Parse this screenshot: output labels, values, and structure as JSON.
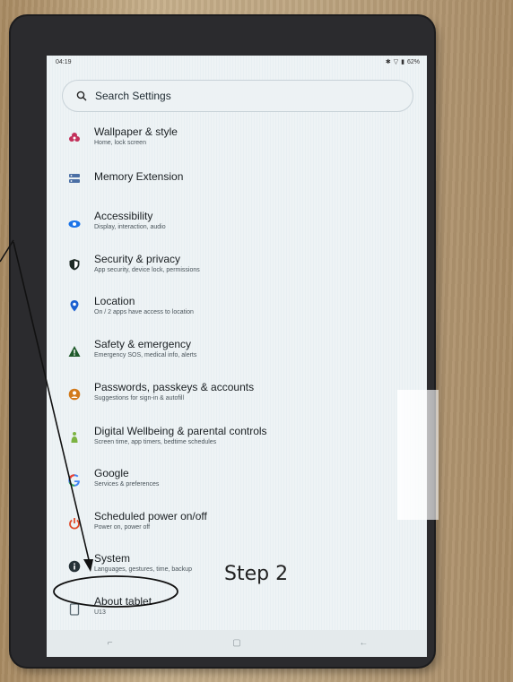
{
  "status_bar": {
    "time": "04:19",
    "battery": "62%"
  },
  "search": {
    "label": "Search Settings"
  },
  "settings": [
    {
      "title": "Wallpaper & style",
      "subtitle": "Home, lock screen",
      "icon": "flower-icon",
      "color": "#c2305a"
    },
    {
      "title": "Memory Extension",
      "subtitle": "",
      "icon": "memory-icon",
      "color": "#4a6fa5"
    },
    {
      "title": "Accessibility",
      "subtitle": "Display, interaction, audio",
      "icon": "accessibility-icon",
      "color": "#1a73e8"
    },
    {
      "title": "Security & privacy",
      "subtitle": "App security, device lock, permissions",
      "icon": "shield-icon",
      "color": "#1e2a24"
    },
    {
      "title": "Location",
      "subtitle": "On / 2 apps have access to location",
      "icon": "location-pin-icon",
      "color": "#1a5fd0"
    },
    {
      "title": "Safety & emergency",
      "subtitle": "Emergency SOS, medical info, alerts",
      "icon": "warning-icon",
      "color": "#1f5a2b"
    },
    {
      "title": "Passwords, passkeys & accounts",
      "subtitle": "Suggestions for sign-in & autofill",
      "icon": "account-icon",
      "color": "#d27a1a"
    },
    {
      "title": "Digital Wellbeing & parental controls",
      "subtitle": "Screen time, app timers, bedtime schedules",
      "icon": "wellbeing-icon",
      "color": "#7cb342"
    },
    {
      "title": "Google",
      "subtitle": "Services & preferences",
      "icon": "google-icon",
      "color": "#4285f4"
    },
    {
      "title": "Scheduled power on/off",
      "subtitle": "Power on, power off",
      "icon": "power-icon",
      "color": "#e04b2c"
    },
    {
      "title": "System",
      "subtitle": "Languages, gestures, time, backup",
      "icon": "info-icon",
      "color": "#263238"
    },
    {
      "title": "About tablet",
      "subtitle": "U13",
      "icon": "tablet-icon",
      "color": "#5a6a72"
    }
  ],
  "annotation": {
    "step_label": "Step 2"
  }
}
